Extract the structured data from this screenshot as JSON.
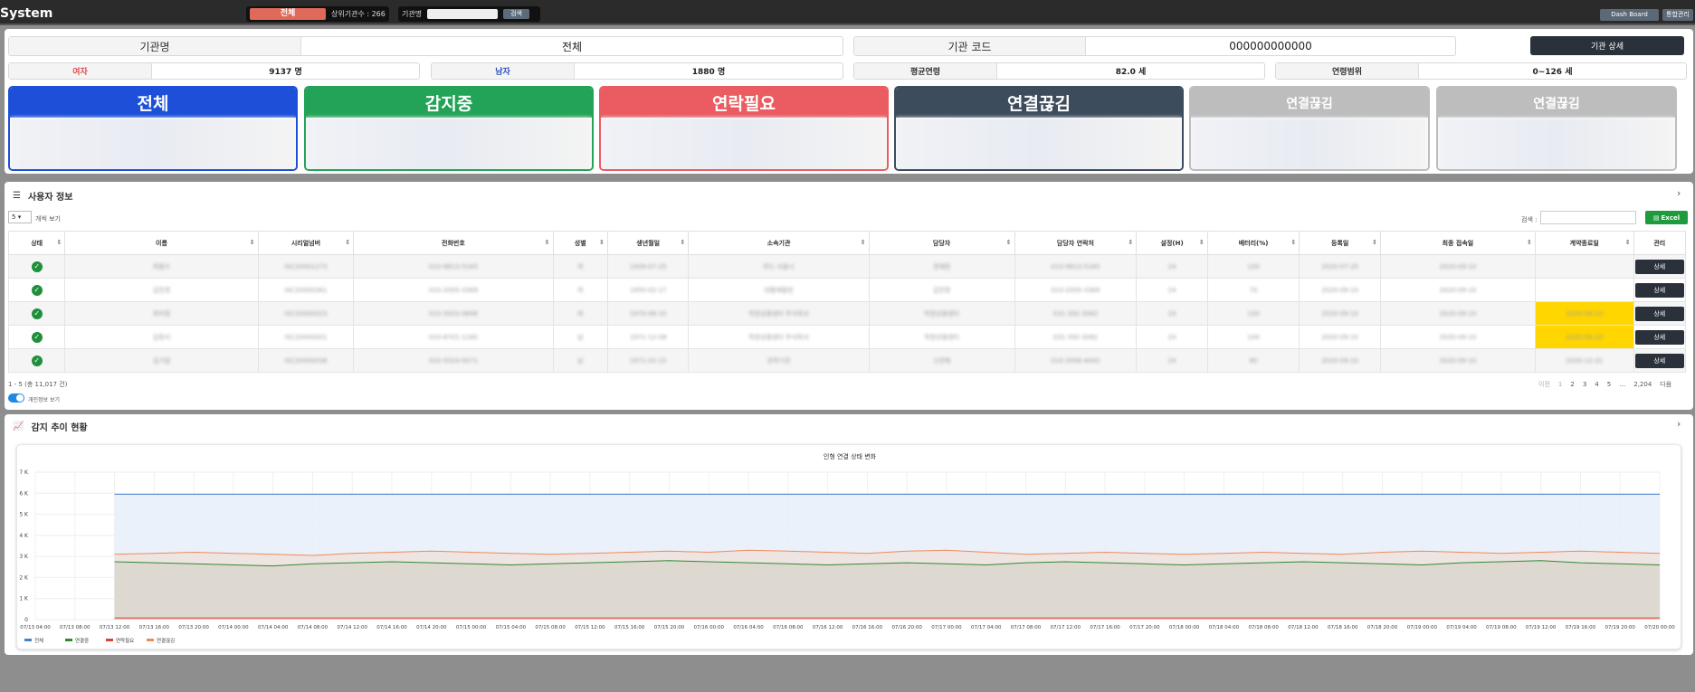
{
  "topbar": {
    "brand": "System",
    "all_label": "전체",
    "sub_count": "상위기관수 : 266",
    "org_label": "기관명",
    "search_btn": "검색",
    "dashboard_btn": "Dash Board",
    "admin_btn": "통합관리"
  },
  "info": {
    "org_name_label": "기관명",
    "org_name": "전체",
    "org_code_label": "기관 코드",
    "org_code": "000000000000",
    "org_detail_btn": "기관 상세",
    "female_label": "여자",
    "female_value": "9137 명",
    "male_label": "남자",
    "male_value": "1880 명",
    "avg_age_label": "평균연령",
    "avg_age": "82.0 세",
    "age_range_label": "연령범위",
    "age_range": "0~126 세"
  },
  "cards": [
    {
      "label": "전체",
      "color": "#1d4fd8"
    },
    {
      "label": "감지중",
      "color": "#23a357"
    },
    {
      "label": "연락필요",
      "color": "#ea5b62"
    },
    {
      "label": "연결끊김",
      "color": "#3d4c5c"
    },
    {
      "label": "연결끊김",
      "color": "#bdbdbd"
    },
    {
      "label": "연결끊김",
      "color": "#bdbdbd"
    }
  ],
  "users": {
    "title": "사용자 정보",
    "page_size": "5",
    "page_size_suffix": "개씩 보기",
    "search_label": "검색 :",
    "excel_btn": "Excel",
    "columns": [
      "상태",
      "이름",
      "시리얼넘버",
      "전화번호",
      "성별",
      "생년월일",
      "소속기관",
      "담당자",
      "담당자 연락처",
      "설정(H)",
      "배터리(%)",
      "등록일",
      "최종 접속일",
      "계약종료일",
      "관리"
    ],
    "rows": [
      [
        "✓",
        "최필수",
        "ISC20001273",
        "010-9613-5165",
        "여",
        "1939-07-25",
        "하드 서울시",
        "경재원",
        "010-9613-5165",
        "24",
        "100",
        "2020-07-25",
        "2020-09-10",
        "",
        "상세"
      ],
      [
        "✓",
        "김진영",
        "ISC20000261",
        "010-2005-3369",
        "여",
        "1950-02-17",
        "대필재활원",
        "김진영",
        "010-2005-3369",
        "24",
        "70",
        "2020-09-10",
        "2020-09-10",
        "",
        "상세"
      ],
      [
        "✓",
        "최미정",
        "ISC20000023",
        "010-3933-0846",
        "여",
        "1970-08-10",
        "학원상황센터 주식회사",
        "학원상황센터",
        "031-392-3082",
        "24",
        "100",
        "2020-09-10",
        "2020-09-10",
        "2020-09-10",
        "상세"
      ],
      [
        "✓",
        "김정서",
        "ISC20000001",
        "010-8701-1180",
        "남",
        "1971-12-08",
        "학원상황센터 주식회사",
        "학원상황센터",
        "031-392-3082",
        "24",
        "100",
        "2020-09-10",
        "2020-09-10",
        "2020-09-10",
        "상세"
      ],
      [
        "✓",
        "김기일",
        "ISC20000038",
        "010-5024-0071",
        "남",
        "1971-02-15",
        "관하기관",
        "고관해",
        "010-3956-4042",
        "24",
        "80",
        "2020-09-10",
        "2020-09-10",
        "2020-12-31",
        "상세"
      ]
    ],
    "summary": "1 - 5 (총 11,017 건)",
    "privacy_toggle": "개인정보 보기",
    "pager": [
      "이전",
      "1",
      "2",
      "3",
      "4",
      "5",
      "…",
      "2,204",
      "다음"
    ]
  },
  "trend": {
    "title": "감지 추이 현황"
  },
  "chart_data": {
    "type": "area",
    "title": "인형 연결 상태 변화",
    "y_ticks": [
      "0",
      "1 K",
      "2 K",
      "3 K",
      "4 K",
      "5 K",
      "6 K",
      "7 K"
    ],
    "ylim": [
      0,
      7000
    ],
    "x": [
      "07/13 04:00",
      "07/13 08:00",
      "07/13 12:00",
      "07/13 16:00",
      "07/13 20:00",
      "07/14 00:00",
      "07/14 04:00",
      "07/14 08:00",
      "07/14 12:00",
      "07/14 16:00",
      "07/14 20:00",
      "07/15 00:00",
      "07/15 04:00",
      "07/15 08:00",
      "07/15 12:00",
      "07/15 16:00",
      "07/15 20:00",
      "07/16 00:00",
      "07/16 04:00",
      "07/16 08:00",
      "07/16 12:00",
      "07/16 16:00",
      "07/16 20:00",
      "07/17 00:00",
      "07/17 04:00",
      "07/17 08:00",
      "07/17 12:00",
      "07/17 16:00",
      "07/17 20:00",
      "07/18 00:00",
      "07/18 04:00",
      "07/18 08:00",
      "07/18 12:00",
      "07/18 16:00",
      "07/18 20:00",
      "07/19 00:00",
      "07/19 04:00",
      "07/19 08:00",
      "07/19 12:00",
      "07/19 16:00",
      "07/19 20:00",
      "07/20 00:00"
    ],
    "series": [
      {
        "name": "전체",
        "color": "#4a7fd0",
        "fill": "#e6eef9",
        "values": [
          null,
          null,
          5950,
          5950,
          5950,
          5950,
          5950,
          5950,
          5950,
          5950,
          5950,
          5950,
          5950,
          5950,
          5950,
          5950,
          5950,
          5950,
          5950,
          5950,
          5950,
          5950,
          5950,
          5950,
          5950,
          5950,
          5950,
          5950,
          5950,
          5950,
          5950,
          5950,
          5950,
          5950,
          5950,
          5950,
          5950,
          5950,
          5950,
          5950,
          5950,
          5950
        ]
      },
      {
        "name": "연결끊김",
        "color": "#ef8a5a",
        "fill": "#efe3de",
        "values": [
          null,
          null,
          3100,
          3150,
          3200,
          3150,
          3100,
          3050,
          3150,
          3200,
          3250,
          3200,
          3150,
          3100,
          3150,
          3200,
          3250,
          3200,
          3300,
          3250,
          3200,
          3150,
          3250,
          3300,
          3200,
          3100,
          3150,
          3200,
          3150,
          3100,
          3150,
          3200,
          3150,
          3100,
          3200,
          3250,
          3200,
          3150,
          3200,
          3250,
          3200,
          3150
        ]
      },
      {
        "name": "연결중",
        "color": "#2e8b2e",
        "fill": "#d9d7cc",
        "values": [
          null,
          null,
          2750,
          2700,
          2650,
          2600,
          2550,
          2650,
          2700,
          2750,
          2700,
          2650,
          2600,
          2650,
          2700,
          2750,
          2800,
          2750,
          2700,
          2650,
          2600,
          2650,
          2700,
          2650,
          2600,
          2700,
          2750,
          2700,
          2650,
          2600,
          2650,
          2700,
          2750,
          2700,
          2650,
          2600,
          2700,
          2750,
          2800,
          2700,
          2650,
          2600
        ]
      },
      {
        "name": "연락필요",
        "color": "#d9413a",
        "fill": "#e8c9c0",
        "values": [
          null,
          null,
          80,
          80,
          80,
          80,
          80,
          80,
          80,
          80,
          80,
          80,
          80,
          80,
          80,
          80,
          80,
          80,
          80,
          80,
          80,
          80,
          80,
          80,
          80,
          80,
          80,
          80,
          80,
          80,
          80,
          80,
          80,
          80,
          80,
          80,
          80,
          80,
          80,
          80,
          80,
          80
        ]
      }
    ]
  }
}
